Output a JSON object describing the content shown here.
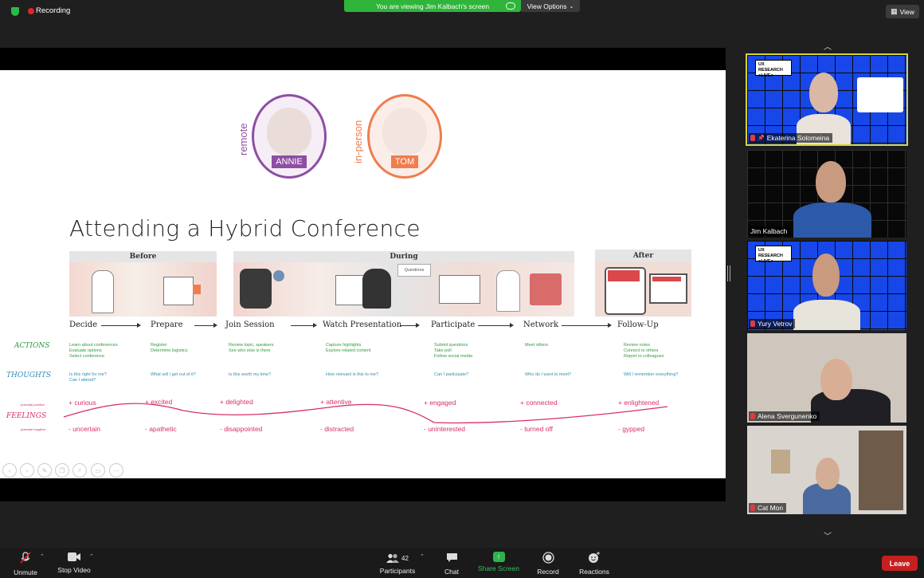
{
  "topbar": {
    "recording_label": "Recording",
    "banner_text": "You are viewing Jim Kalbach's screen",
    "view_options_label": "View Options",
    "view_label": "View"
  },
  "slide": {
    "title": "Attending a Hybrid Conference",
    "personas": [
      {
        "mode": "remote",
        "name": "ANNIE",
        "color": "#8e4ea3"
      },
      {
        "mode": "in-person",
        "name": "TOM",
        "color": "#ef7d4e"
      }
    ],
    "phases": [
      "Before",
      "During",
      "After"
    ],
    "steps": [
      "Decide",
      "Prepare",
      "Join Session",
      "Watch Presentation",
      "Participate",
      "Network",
      "Follow-Up"
    ],
    "scene_caption": "Questions",
    "row_labels": {
      "actions": "ACTIONS",
      "thoughts": "THOUGHTS",
      "feelings": "FEELINGS"
    },
    "feelings_axis": {
      "positive": "potential positive",
      "negative": "potential negative"
    },
    "actions": [
      "Learn about conferences\nEvaluate options\nSelect conference",
      "Register\nDetermine logistics",
      "Review topic, speakers\nSee who else is there",
      "Capture highlights\nExplore related content",
      "Submit questions\nTake poll\nFollow social media",
      "Meet others",
      "Review notes\nConnect to others\nReport to colleagues"
    ],
    "thoughts": [
      "Is this right for me?\nCan I attend?",
      "What will I get out of it?",
      "Is this worth my time?",
      "How relevant is this to me?",
      "Can I participate?",
      "Who do I want to meet?",
      "Will I remember everything?"
    ],
    "feelings_positive": [
      "+ curious",
      "+ excited",
      "+ delighted",
      "+ attentive",
      "+ engaged",
      "+ connected",
      "+ enlightened"
    ],
    "feelings_negative": [
      "- uncertain",
      "- apathetic",
      "- disappointed",
      "- distracted",
      "- uninterested",
      "- turned off",
      "- gypped"
    ],
    "accent_color": "#d6306a"
  },
  "gallery": {
    "participants": [
      {
        "name": "Ekaterina Solomeina",
        "badge": "UX RESEARCH\n●LIVE●",
        "active": true
      },
      {
        "name": "Jim Kalbach",
        "badge": "",
        "active": false
      },
      {
        "name": "Yury Vetrov",
        "badge": "UX RESEARCH\n●LIVE●",
        "active": false
      },
      {
        "name": "Alena Svergunenko",
        "badge": "",
        "active": false
      },
      {
        "name": "Cat Mon",
        "badge": "",
        "active": false
      }
    ]
  },
  "toolbar": {
    "unmute": "Unmute",
    "stop_video": "Stop Video",
    "participants": "Participants",
    "participants_count": "42",
    "chat": "Chat",
    "share_screen": "Share Screen",
    "record": "Record",
    "reactions": "Reactions",
    "leave": "Leave"
  }
}
